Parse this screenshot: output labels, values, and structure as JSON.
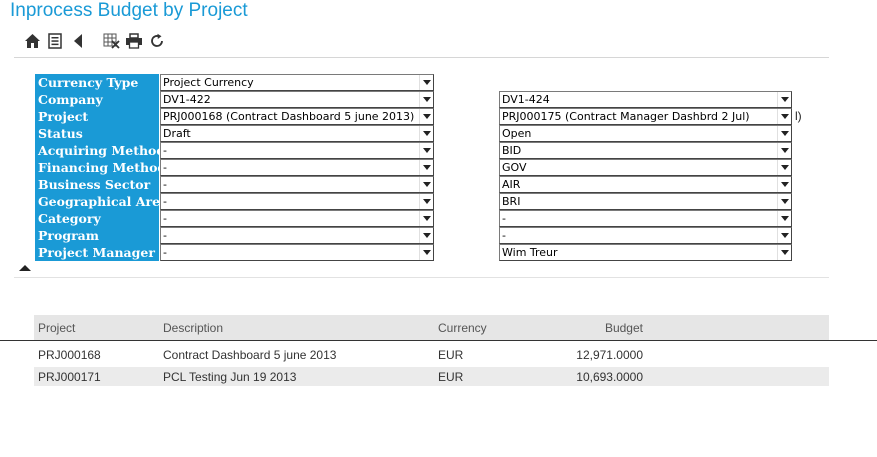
{
  "page": {
    "title": "Inprocess Budget by Project"
  },
  "toolbar": {
    "buttons": [
      {
        "icon": "home-icon"
      },
      {
        "icon": "list-icon"
      },
      {
        "icon": "back-icon"
      },
      {
        "icon": "export-excel-icon"
      },
      {
        "icon": "print-icon"
      },
      {
        "icon": "refresh-icon"
      }
    ]
  },
  "filters": {
    "rows": [
      {
        "label": "Currency Type",
        "value_a": "Project Currency",
        "value_b": null
      },
      {
        "label": "Company",
        "value_a": "DV1-422",
        "value_b": "DV1-424"
      },
      {
        "label": "Project",
        "value_a": "PRJ000168 (Contract Dashboard 5 june 2013)",
        "value_b": "PRJ000175 (Contract Manager Dashbrd 2 Jul)",
        "fragment": "l)"
      },
      {
        "label": "Status",
        "value_a": "Draft",
        "value_b": "Open"
      },
      {
        "label": "Acquiring Method",
        "value_a": "-",
        "value_b": "BID"
      },
      {
        "label": "Financing Method",
        "value_a": "-",
        "value_b": "GOV"
      },
      {
        "label": "Business Sector",
        "value_a": "-",
        "value_b": "AIR"
      },
      {
        "label": "Geographical Area",
        "value_a": "-",
        "value_b": "BRI"
      },
      {
        "label": "Category",
        "value_a": "-",
        "value_b": "-"
      },
      {
        "label": "Program",
        "value_a": "-",
        "value_b": "-"
      },
      {
        "label": "Project Manager",
        "value_a": "-",
        "value_b": "Wim Treur"
      }
    ]
  },
  "grid": {
    "headers": {
      "project": "Project",
      "description": "Description",
      "currency": "Currency",
      "budget": "Budget"
    },
    "rows": [
      {
        "project": "PRJ000168",
        "description": "Contract Dashboard 5 june 2013",
        "currency": "EUR",
        "budget": "12,971.0000"
      },
      {
        "project": "PRJ000171",
        "description": "PCL Testing Jun 19 2013",
        "currency": "EUR",
        "budget": "10,693.0000"
      }
    ]
  }
}
